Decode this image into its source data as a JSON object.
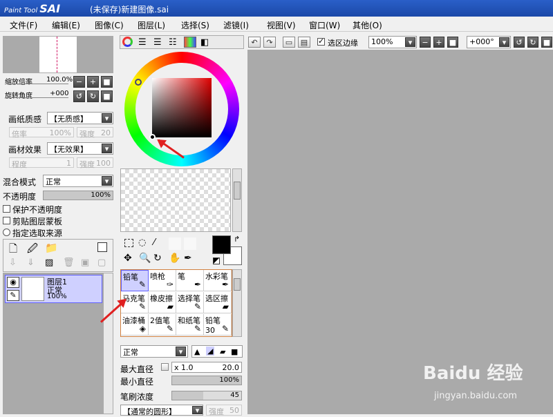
{
  "window": {
    "logo_small": "Paint Tool",
    "logo": "SAI",
    "title": "(未保存)新建图像.sai"
  },
  "menu": [
    "文件(F)",
    "编辑(E)",
    "图像(C)",
    "图层(L)",
    "选择(S)",
    "滤镜(I)",
    "视图(V)",
    "窗口(W)",
    "其他(O)"
  ],
  "toolbar": {
    "selection_edge": "选区边缘",
    "zoom": "100%",
    "rotation": "+000°"
  },
  "navigator": {
    "zoom_label": "缩放倍率",
    "zoom_value": "100.0%",
    "rotate_label": "旋转角度",
    "rotate_value": "+000"
  },
  "paper": {
    "texture_label": "画纸质感",
    "texture_value": "【无质感】",
    "scale_label": "倍率",
    "scale_value": "100%",
    "strength_label": "强度",
    "strength_value": "20",
    "effect_label": "画材效果",
    "effect_value": "【无效果】",
    "degree_label": "程度",
    "degree_value": "1",
    "effect_strength_label": "强度",
    "effect_strength_value": "100"
  },
  "layer": {
    "blend_label": "混合模式",
    "blend_value": "正常",
    "opacity_label": "不透明度",
    "opacity_value": "100%",
    "protect_opacity": "保护不透明度",
    "clip_mask": "剪贴图层蒙板",
    "selection_source": "指定选取来源"
  },
  "layer_item": {
    "name": "图层1",
    "mode": "正常",
    "opacity": "100%"
  },
  "tools": [
    {
      "name": "铅笔",
      "icon": "✎",
      "selected": true
    },
    {
      "name": "喷枪",
      "icon": "✑",
      "selected": false
    },
    {
      "name": "笔",
      "icon": "✒",
      "selected": false
    },
    {
      "name": "水彩笔",
      "icon": "✒",
      "selected": false
    },
    {
      "name": "马克笔",
      "icon": "✎",
      "selected": false
    },
    {
      "name": "橡皮擦",
      "icon": "▰",
      "selected": false
    },
    {
      "name": "选择笔",
      "icon": "✎",
      "selected": false
    },
    {
      "name": "选区擦",
      "icon": "▰",
      "selected": false
    },
    {
      "name": "油漆桶",
      "icon": "◈",
      "selected": false
    },
    {
      "name": "2值笔",
      "icon": "✎",
      "selected": false
    },
    {
      "name": "和纸笔",
      "icon": "✎",
      "selected": false
    },
    {
      "name": "铅笔30",
      "icon": "✎",
      "selected": false
    }
  ],
  "brush": {
    "mode": "正常",
    "max_diam_label": "最大直径",
    "max_diam_mult": "x 1.0",
    "max_diam_value": "20.0",
    "min_diam_label": "最小直径",
    "min_diam_value": "100%",
    "min_diam_fill": 1.0,
    "density_label": "笔刷浓度",
    "density_value": "45",
    "density_fill": 0.45,
    "shape": "【通常的圆形】",
    "shape_strength_label": "强度",
    "shape_strength_value": "50"
  },
  "watermark": {
    "brand": "Baidu 经验",
    "url": "jingyan.baidu.com"
  },
  "colors": {
    "accent": "#2a5fc8",
    "arrow": "#e02020",
    "selection": "#cfd0ff",
    "canvas": "#aaaaaa"
  }
}
